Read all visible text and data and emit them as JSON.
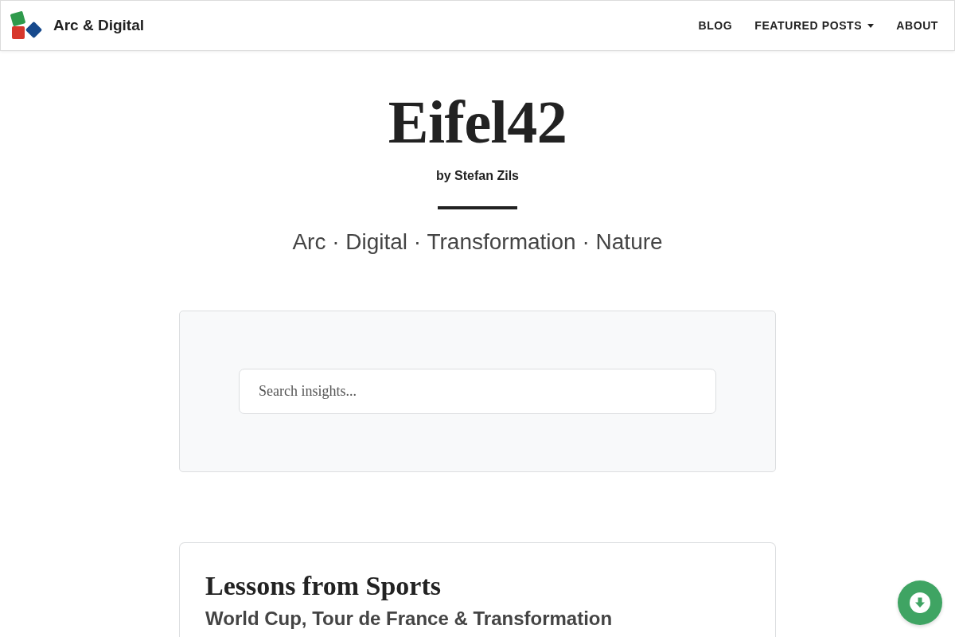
{
  "navbar": {
    "brand": "Arc & Digital",
    "links": [
      {
        "label": "BLOG",
        "dropdown": false
      },
      {
        "label": "FEATURED POSTS",
        "dropdown": true
      },
      {
        "label": "ABOUT",
        "dropdown": false
      }
    ]
  },
  "header": {
    "title": "Eifel42",
    "byline": "by Stefan Zils",
    "tagline": "Arc · Digital · Transformation · Nature"
  },
  "search": {
    "placeholder": "Search insights..."
  },
  "posts": [
    {
      "title": "Lessons from Sports",
      "subtitle": "World Cup, Tour de France & Transformation"
    }
  ]
}
